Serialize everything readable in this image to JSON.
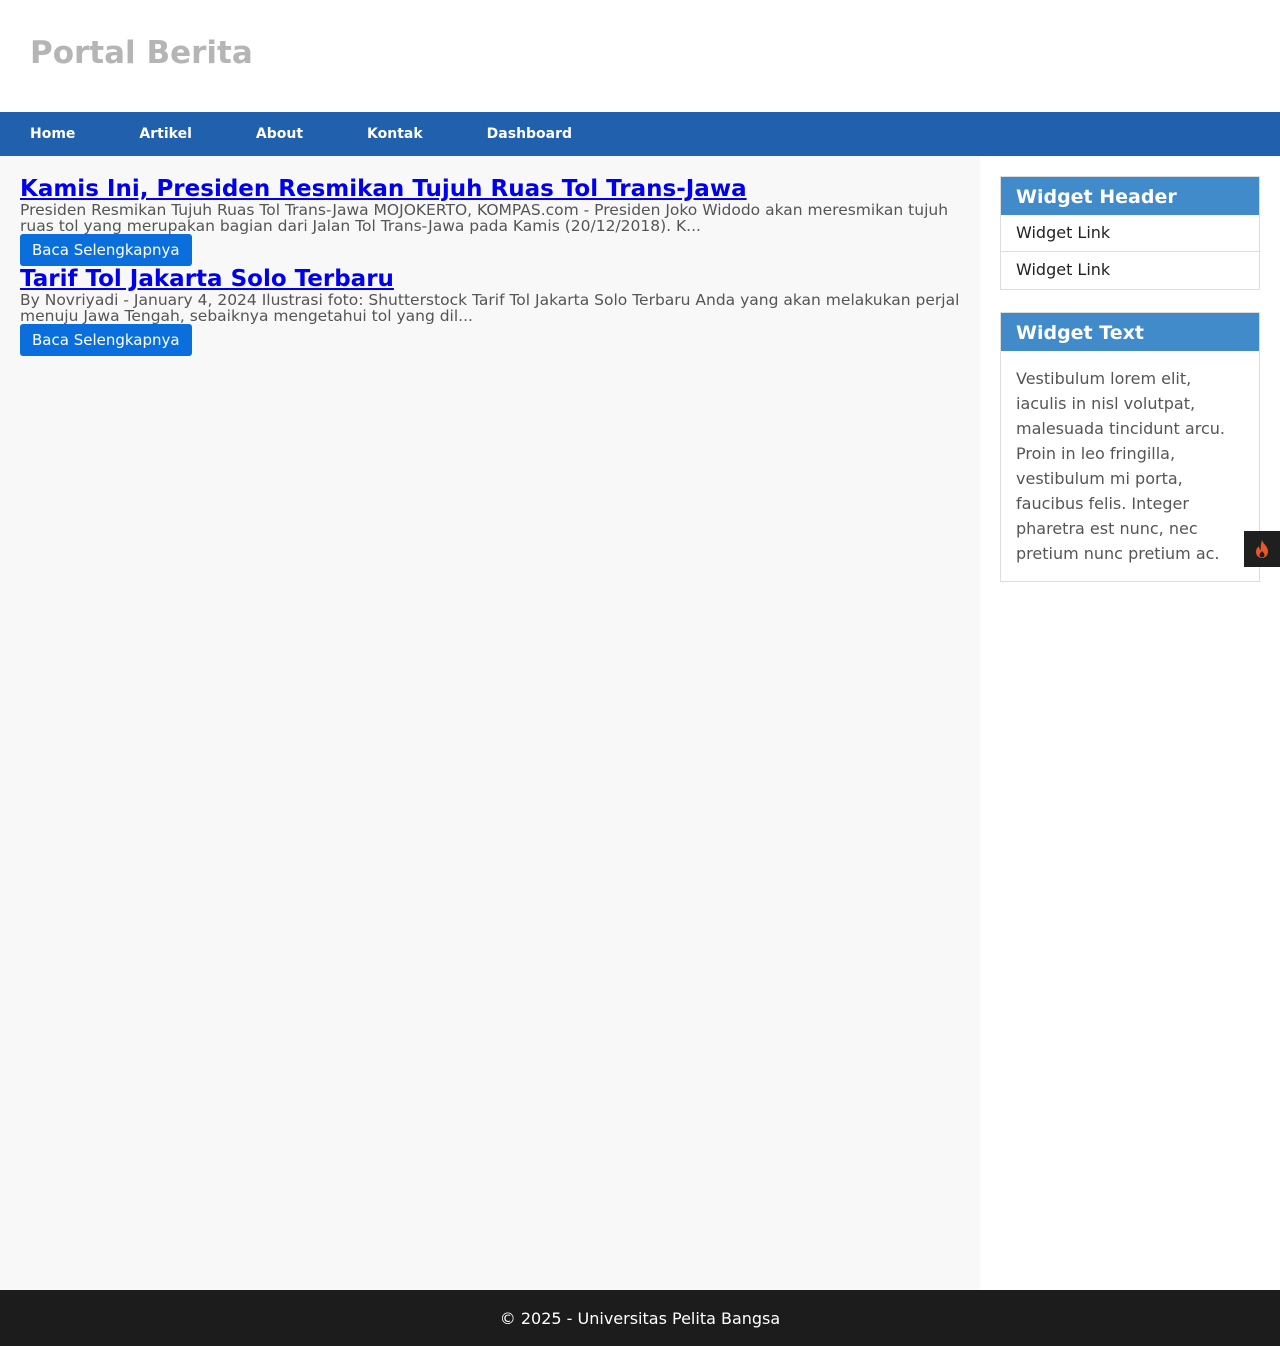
{
  "header": {
    "site_title": "Portal Berita"
  },
  "nav": {
    "items": [
      "Home",
      "Artikel",
      "About",
      "Kontak",
      "Dashboard"
    ]
  },
  "articles": [
    {
      "title": "Kamis Ini, Presiden Resmikan Tujuh Ruas Tol Trans-Jawa",
      "excerpt_line1": "Presiden Resmikan Tujuh Ruas Tol Trans-Jawa MOJOKERTO, KOMPAS.com - Presiden Joko Widodo akan meresmikan tujuh",
      "excerpt_line2": "ruas tol yang merupakan bagian dari Jalan Tol Trans-Jawa pada Kamis (20/12/2018). K...",
      "button": "Baca Selengkapnya"
    },
    {
      "title": "Tarif Tol Jakarta Solo Terbaru",
      "excerpt_line1": "By Novriyadi - January 4, 2024 Ilustrasi foto: Shutterstock Tarif Tol Jakarta Solo Terbaru Anda yang akan melakukan perjalanan",
      "excerpt_line2": "menuju Jawa Tengah, sebaiknya mengetahui tol yang dil...",
      "button": "Baca Selengkapnya"
    }
  ],
  "sidebar": {
    "widget_links": {
      "header": "Widget Header",
      "links": [
        "Widget Link",
        "Widget Link"
      ]
    },
    "widget_text": {
      "header": "Widget Text",
      "body": "Vestibulum lorem elit, iaculis in nisl volutpat, malesuada tincidunt arcu. Proin in leo fringilla, vestibulum mi porta, faucibus felis. Integer pharetra est nunc, nec pretium nunc pretium ac."
    }
  },
  "floating_button": {
    "icon": "flame-icon",
    "color": "#e8562a"
  },
  "footer": {
    "text": "© 2025 - Universitas Pelita Bangsa"
  },
  "colors": {
    "nav": "#2160ac",
    "widget_header": "#428bca",
    "button": "#0a6fdc",
    "footer": "#1c1c1c"
  }
}
